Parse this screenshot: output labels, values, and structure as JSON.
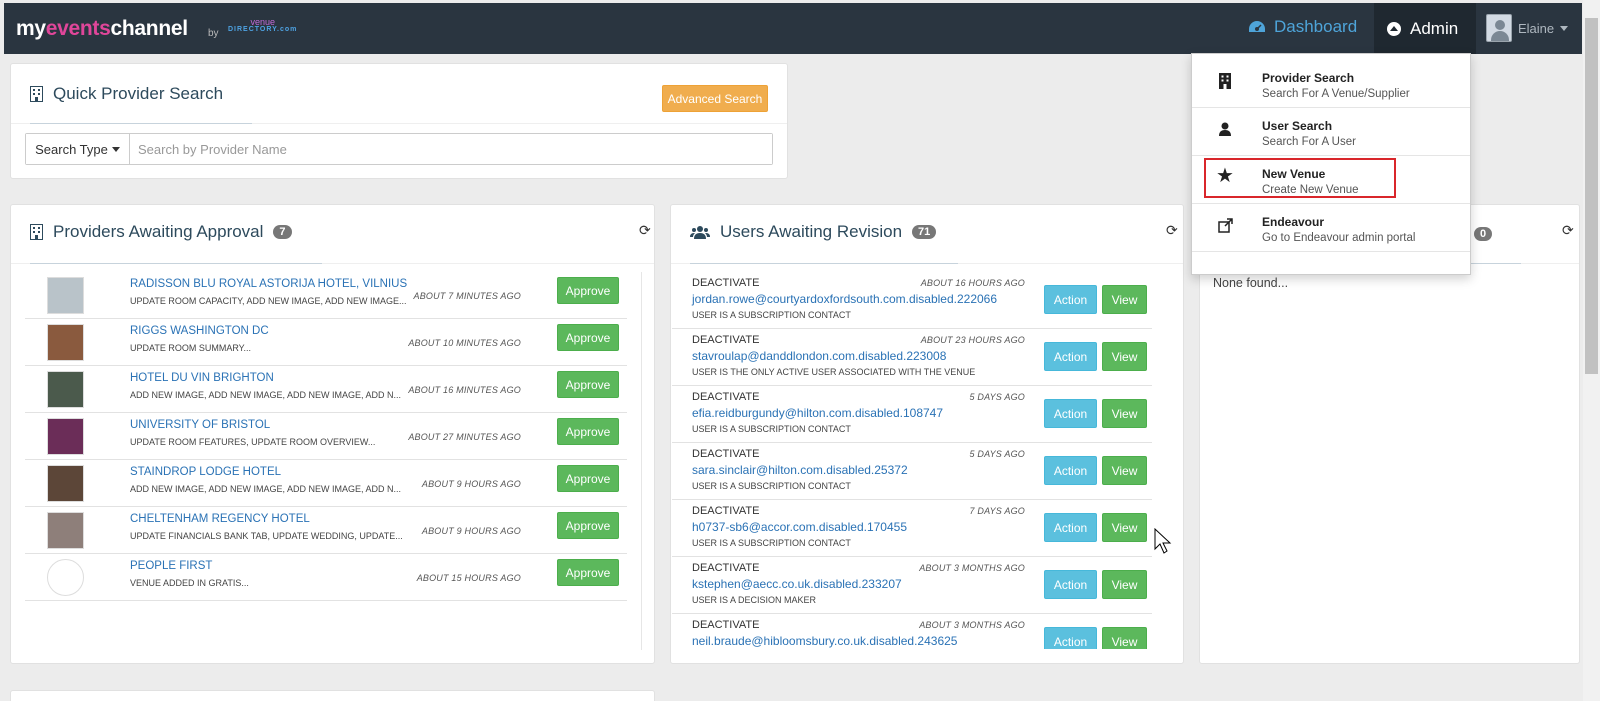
{
  "navbar": {
    "brand_part1": "my",
    "brand_part2": "events",
    "brand_part3": "channel",
    "brand_by": "by",
    "brand_venue": "venue",
    "brand_directory": "DIRECTORY.com",
    "dashboard": "Dashboard",
    "admin": "Admin",
    "user": "Elaine"
  },
  "quick_search": {
    "title": "Quick Provider Search",
    "advanced_button": "Advanced Search",
    "search_type": "Search Type",
    "placeholder": "Search by Provider Name"
  },
  "providers": {
    "title": "Providers Awaiting Approval",
    "count": "7",
    "approve_label": "Approve",
    "items": [
      {
        "name": "RADISSON BLU ROYAL ASTORIJA HOTEL, VILNIUS",
        "sub": "UPDATE ROOM CAPACITY, ADD NEW IMAGE, ADD NEW IMAGE...",
        "time": "ABOUT 7 MINUTES AGO",
        "thumb_color": "#b9c3c9"
      },
      {
        "name": "RIGGS WASHINGTON DC",
        "sub": "UPDATE ROOM SUMMARY...",
        "time": "ABOUT 10 MINUTES AGO",
        "thumb_color": "#8a5a3e"
      },
      {
        "name": "HOTEL DU VIN BRIGHTON",
        "sub": "ADD NEW IMAGE, ADD NEW IMAGE, ADD NEW IMAGE, ADD N...",
        "time": "ABOUT 16 MINUTES AGO",
        "thumb_color": "#4b5a4c"
      },
      {
        "name": "UNIVERSITY OF BRISTOL",
        "sub": "UPDATE ROOM FEATURES, UPDATE ROOM OVERVIEW...",
        "time": "ABOUT 27 MINUTES AGO",
        "thumb_color": "#6b2d58"
      },
      {
        "name": "STAINDROP LODGE HOTEL",
        "sub": "ADD NEW IMAGE, ADD NEW IMAGE, ADD NEW IMAGE, ADD N...",
        "time": "ABOUT 9 HOURS AGO",
        "thumb_color": "#5c4638"
      },
      {
        "name": "CHELTENHAM REGENCY HOTEL",
        "sub": "UPDATE FINANCIALS BANK TAB, UPDATE WEDDING, UPDATE...",
        "time": "ABOUT 9 HOURS AGO",
        "thumb_color": "#8e7f7a"
      },
      {
        "name": "PEOPLE FIRST",
        "sub": "VENUE ADDED IN GRATIS...",
        "time": "ABOUT 15 HOURS AGO",
        "thumb_color": "#ffffff"
      }
    ]
  },
  "users": {
    "title": "Users Awaiting Revision",
    "count": "71",
    "action_label": "Action",
    "view_label": "View",
    "items": [
      {
        "title": "DEACTIVATE",
        "email": "jordan.rowe@courtyardoxfordsouth.com.disabled.222066",
        "note": "USER IS A SUBSCRIPTION CONTACT",
        "time": "ABOUT 16 HOURS AGO"
      },
      {
        "title": "DEACTIVATE",
        "email": "stavroulap@danddlondon.com.disabled.223008",
        "note": "USER IS THE ONLY ACTIVE USER ASSOCIATED WITH THE VENUE",
        "time": "ABOUT 23 HOURS AGO"
      },
      {
        "title": "DEACTIVATE",
        "email": "efia.reidburgundy@hilton.com.disabled.108747",
        "note": "USER IS A SUBSCRIPTION CONTACT",
        "time": "5 DAYS AGO"
      },
      {
        "title": "DEACTIVATE",
        "email": "sara.sinclair@hilton.com.disabled.25372",
        "note": "USER IS A SUBSCRIPTION CONTACT",
        "time": "5 DAYS AGO"
      },
      {
        "title": "DEACTIVATE",
        "email": "h0737-sb6@accor.com.disabled.170455",
        "note": "USER IS A SUBSCRIPTION CONTACT",
        "time": "7 DAYS AGO"
      },
      {
        "title": "DEACTIVATE",
        "email": "kstephen@aecc.co.uk.disabled.233207",
        "note": "USER IS A DECISION MAKER",
        "time": "ABOUT 3 MONTHS AGO"
      },
      {
        "title": "DEACTIVATE",
        "email": "neil.braude@hibloomsbury.co.uk.disabled.243625",
        "note": "",
        "time": "ABOUT 3 MONTHS AGO"
      }
    ]
  },
  "third_panel": {
    "count": "0",
    "empty_text": "None found..."
  },
  "admin_menu": {
    "items": [
      {
        "title": "Provider Search",
        "sub": "Search For A Venue/Supplier",
        "icon": "building-icon"
      },
      {
        "title": "User Search",
        "sub": "Search For A User",
        "icon": "user-icon"
      },
      {
        "title": "New Venue",
        "sub": "Create New Venue",
        "icon": "star-icon"
      },
      {
        "title": "Endeavour",
        "sub": "Go to Endeavour admin portal",
        "icon": "external-link-icon"
      }
    ]
  },
  "colors": {
    "navbar": "#2a3540",
    "approve": "#5cb85c",
    "action": "#5bc0de",
    "advanced": "#f0ad4e",
    "highlight": "#d9262b"
  }
}
